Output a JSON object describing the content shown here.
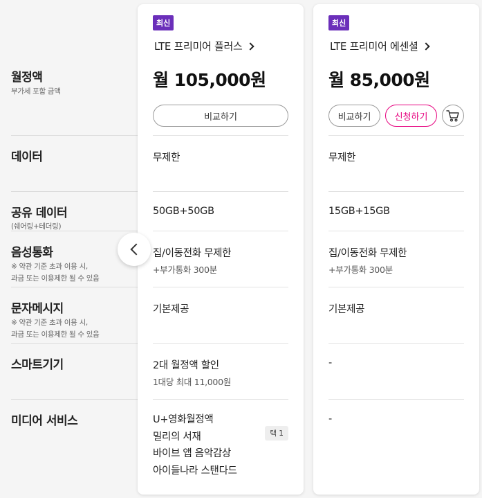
{
  "labels": {
    "monthly_fee": "월정액",
    "monthly_fee_sub": "부가세 포함 금액",
    "data": "데이터",
    "shared_data": "공유 데이터",
    "shared_data_sub": "(쉐어링+테더링)",
    "voice": "음성통화",
    "voice_sub1": "※ 약관 기준 초과 이용 시,",
    "voice_sub2": "과금 또는 이용제한 될 수 있음",
    "sms": "문자메시지",
    "sms_sub1": "※ 약관 기준 초과 이용 시,",
    "sms_sub2": "과금 또는 이용제한 될 수 있음",
    "smart_device": "스마트기기",
    "media": "미디어 서비스"
  },
  "plans": [
    {
      "badge": "최신",
      "name": "LTE 프리미어 플러스",
      "price": "월 105,000원",
      "compare_label": "비교하기",
      "data": "무제한",
      "shared_data": "50GB+50GB",
      "voice": "집/이동전화 무제한",
      "voice_sub": "+부가통화 300분",
      "sms": "기본제공",
      "smart_device": "2대 월정액 할인",
      "smart_device_sub": "1대당 최대 11,000원",
      "media": [
        "U+영화월정액",
        "밀리의 서재",
        "바이브 앱 음악감상",
        "아이들나라 스탠다드"
      ],
      "media_tag": "택 1"
    },
    {
      "badge": "최신",
      "name": "LTE 프리미어 에센셜",
      "price": "월 85,000원",
      "compare_label": "비교하기",
      "apply_label": "신청하기",
      "data": "무제한",
      "shared_data": "15GB+15GB",
      "voice": "집/이동전화 무제한",
      "voice_sub": "+부가통화 300분",
      "sms": "기본제공",
      "smart_device": "-",
      "media": "-"
    }
  ],
  "icons": {
    "prev": "chevron-left-icon",
    "cart": "cart-icon",
    "detail": "chevron-right-icon"
  },
  "colors": {
    "badge": "#6b2fba",
    "apply": "#e6007e"
  }
}
